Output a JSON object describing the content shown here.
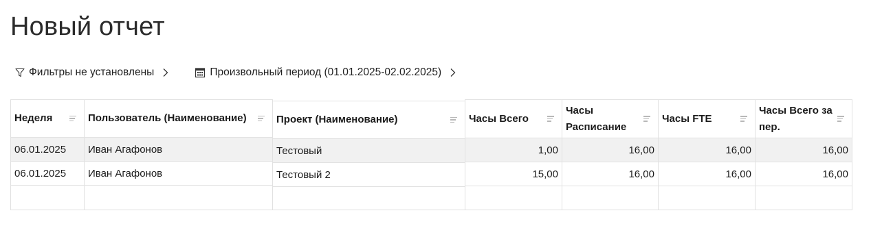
{
  "report": {
    "title": "Новый отчет"
  },
  "toolbar": {
    "filters_label": "Фильтры не установлены",
    "period_label": "Произвольный период (01.01.2025-02.02.2025)"
  },
  "table": {
    "columns": [
      {
        "label": "Неделя",
        "align": "left"
      },
      {
        "label": "Пользователь (Наименование)",
        "align": "left"
      },
      {
        "label": "Проект (Наименование)",
        "align": "left"
      },
      {
        "label": "Часы Всего",
        "align": "left"
      },
      {
        "label": "Часы Расписание",
        "align": "left"
      },
      {
        "label": "Часы FTE",
        "align": "left"
      },
      {
        "label": "Часы Всего за пер.",
        "align": "left"
      }
    ],
    "rows": [
      [
        "06.01.2025",
        "Иван Агафонов",
        "Тестовый",
        "1,00",
        "16,00",
        "16,00",
        "16,00"
      ],
      [
        "06.01.2025",
        "Иван Агафонов",
        "Тестовый 2",
        "15,00",
        "16,00",
        "16,00",
        "16,00"
      ]
    ]
  }
}
